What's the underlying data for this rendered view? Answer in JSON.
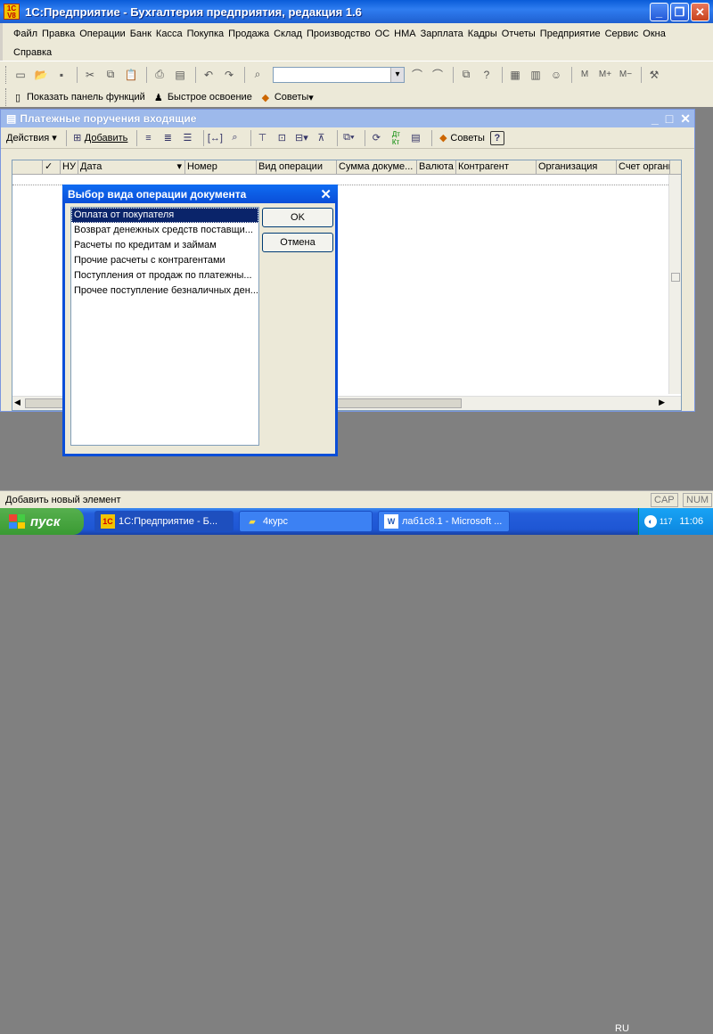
{
  "window": {
    "title": "1С:Предприятие - Бухгалтерия предприятия, редакция 1.6",
    "logo_text": "1C V8"
  },
  "menu": [
    "Файл",
    "Правка",
    "Операции",
    "Банк",
    "Касса",
    "Покупка",
    "Продажа",
    "Склад",
    "Производство",
    "ОС",
    "НМА",
    "Зарплата",
    "Кадры",
    "Отчеты",
    "Предприятие",
    "Сервис",
    "Окна",
    "Справка"
  ],
  "toolbar2": {
    "functions_panel": "Показать панель функций",
    "quick_start": "Быстрое освоение",
    "tips": "Советы"
  },
  "mdi": {
    "title": "Платежные поручения входящие",
    "actions": "Действия",
    "add": "Добавить",
    "tips": "Советы",
    "help": "?",
    "columns": [
      "НУ",
      "Дата",
      "Номер",
      "Вид операции",
      "Сумма докуме...",
      "Валюта",
      "Контрагент",
      "Организация",
      "Счет организа..."
    ]
  },
  "dialog": {
    "title": "Выбор вида операции документа",
    "items": [
      "Оплата от покупателя",
      "Возврат денежных средств поставщи...",
      "Расчеты по кредитам и займам",
      "Прочие расчеты с контрагентами",
      "Поступления от продаж по платежны...",
      "Прочее поступление безналичных ден..."
    ],
    "selected_index": 0,
    "ok": "OK",
    "cancel": "Отмена"
  },
  "status": {
    "text": "Добавить новый элемент",
    "cap": "CAP",
    "num": "NUM"
  },
  "taskbar": {
    "start": "пуск",
    "tasks": [
      "1С:Предприятие - Б...",
      "4курс",
      "лаб1с8.1 - Microsoft ..."
    ],
    "lang": "RU",
    "tray_count": "117",
    "clock": "11:06"
  },
  "colors": {
    "selection": "#0a246a",
    "titlebar": "#0a5cd8",
    "taskbar": "#245edb",
    "start": "#3a9a33"
  }
}
